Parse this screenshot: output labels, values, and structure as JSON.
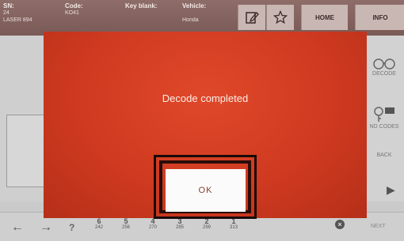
{
  "header": {
    "sn": {
      "label": "SN:",
      "value1": "24",
      "value2": "LASER 894"
    },
    "code": {
      "label": "Code:",
      "value": "KO41"
    },
    "key_blank": {
      "label": "Key blank:"
    },
    "vehicle": {
      "label": "Vehicle:",
      "value": "Honda"
    },
    "home_label": "HOME",
    "info_label": "INFO"
  },
  "side_panel": {
    "decode_label": "DECODE",
    "codes_label": "ND CODES",
    "back_label": "BACK"
  },
  "bottom_bar": {
    "help_label": "?",
    "digits": [
      {
        "digit": "6",
        "sub": "242"
      },
      {
        "digit": "5",
        "sub": "256"
      },
      {
        "digit": "4",
        "sub": "270"
      },
      {
        "digit": "3",
        "sub": "285"
      },
      {
        "digit": "2",
        "sub": "299"
      },
      {
        "digit": "1",
        "sub": "313"
      }
    ],
    "next_label": "NEXT"
  },
  "dialog": {
    "message": "Decode completed",
    "ok_label": "OK"
  },
  "colors": {
    "dialog_bg": "#cf3a20",
    "ok_bg": "#fbfbfb",
    "header_bg": "#8e6d69"
  }
}
